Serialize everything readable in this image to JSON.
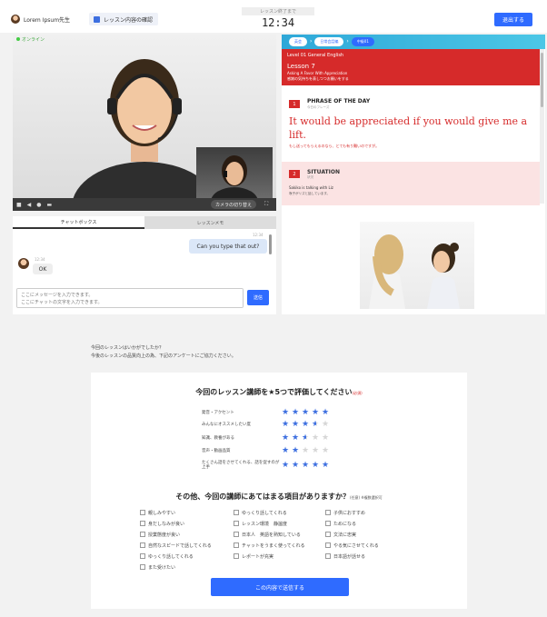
{
  "header": {
    "teacher_name": "Lorem Ipsum先生",
    "confirm_label": "レッスン内容の確認",
    "timer_label": "レッスン終了まで",
    "timer_value": "12:34",
    "exit_label": "退出する"
  },
  "video": {
    "status": "オンライン",
    "camera_switch_label": "カメラの切り替え"
  },
  "chat": {
    "tab_chat": "チャットボックス",
    "tab_memo": "レッスンメモ",
    "messages": [
      {
        "side": "right",
        "time": "12:34",
        "text": "Can you type that out?"
      },
      {
        "side": "left",
        "time": "12:34",
        "text": "OK"
      }
    ],
    "input_placeholder": "ここにメッセージを入力できます。\nここにチャットの文字を入力できます。",
    "send_label": "送信"
  },
  "lesson": {
    "breadcrumbs": [
      "英会",
      "日常会話編",
      "中級01"
    ],
    "level": "Level 01 General English",
    "lesson_title": "Lesson 7",
    "lesson_subtitle": "Asking A Favor With Appreciation",
    "lesson_subtitle_jp": "感謝の気持ちを表しつつお願いをする",
    "phrase_section": {
      "number": "1",
      "title": "PHRASE OF THE DAY",
      "subtitle": "今日のフレーズ"
    },
    "phrase": "It would be appreciated if you would give me a lift.",
    "phrase_jp": "もし送ってもらえるのなら、とても有り難いのですが。",
    "situation_section": {
      "number": "2",
      "title": "SITUATION",
      "subtitle": "状況"
    },
    "situation_text": "Sakiko is talking with Liz",
    "situation_jp": "咲子がリズと話しています。"
  },
  "survey": {
    "intro_line1": "今回のレッスンはいかがでしたか？",
    "intro_line2": "今後のレッスンの品質向上の為、下記のアンケートにご協力ください。",
    "q1_title": "今回のレッスン講師を★5つで評価してください",
    "q1_required": "(必須)",
    "ratings": [
      {
        "label": "発音・アクセント",
        "stars": 5
      },
      {
        "label": "みんなにオススメしたい度",
        "stars": 3.5
      },
      {
        "label": "知識、教養がある",
        "stars": 2.5
      },
      {
        "label": "音声・動画品質",
        "stars": 2
      },
      {
        "label": "たくさん話をさせてくれる、話を促すのが上手",
        "stars": 5
      }
    ],
    "q2_title": "その他、今回の講師にあてはまる項目がありますか？",
    "q2_optional": "(任意) ※複数選択可",
    "options_col1": [
      "親しみやすい",
      "身だしなみが良い",
      "授業態度が良い",
      "自然なスピードで話してくれる",
      "ゆっくり話してくれる",
      "また受けたい"
    ],
    "options_col2": [
      "ゆっくり話してくれる",
      "レッスン環境　静謐度",
      "日本人　英語を熟知している",
      "チャットをうまく使ってくれる",
      "レポートが充実"
    ],
    "options_col3": [
      "子供におすすめ",
      "ためになる",
      "文法に忠実",
      "やる気にさせてくれる",
      "日本語が話せる"
    ],
    "submit_label": "この内容で送信する"
  },
  "colors": {
    "accent": "#2f6bff",
    "lesson_red": "#d62a2a",
    "star": "#3d6fe0"
  }
}
